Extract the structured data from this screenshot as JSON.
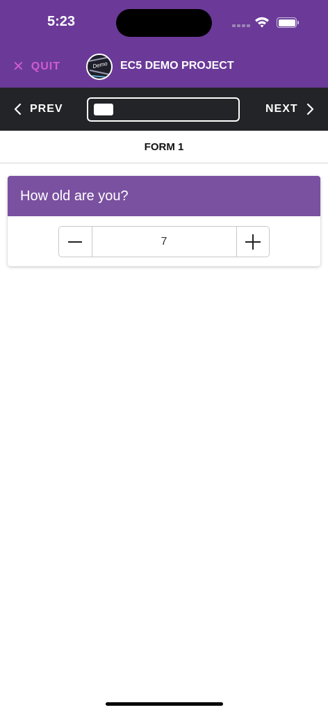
{
  "status_bar": {
    "time": "5:23"
  },
  "header": {
    "quit_label": "QUIT",
    "logo_text": "Demo",
    "project_title": "EC5 DEMO PROJECT"
  },
  "nav": {
    "prev_label": "PREV",
    "next_label": "NEXT",
    "progress_fraction": 0.06
  },
  "form": {
    "title": "FORM 1"
  },
  "question": {
    "text": "How old are you?",
    "value": "7"
  },
  "colors": {
    "header_bg": "#6b3a98",
    "nav_bg": "#232427",
    "question_header_bg": "#7a51a0",
    "quit_color": "#d05cd0"
  }
}
